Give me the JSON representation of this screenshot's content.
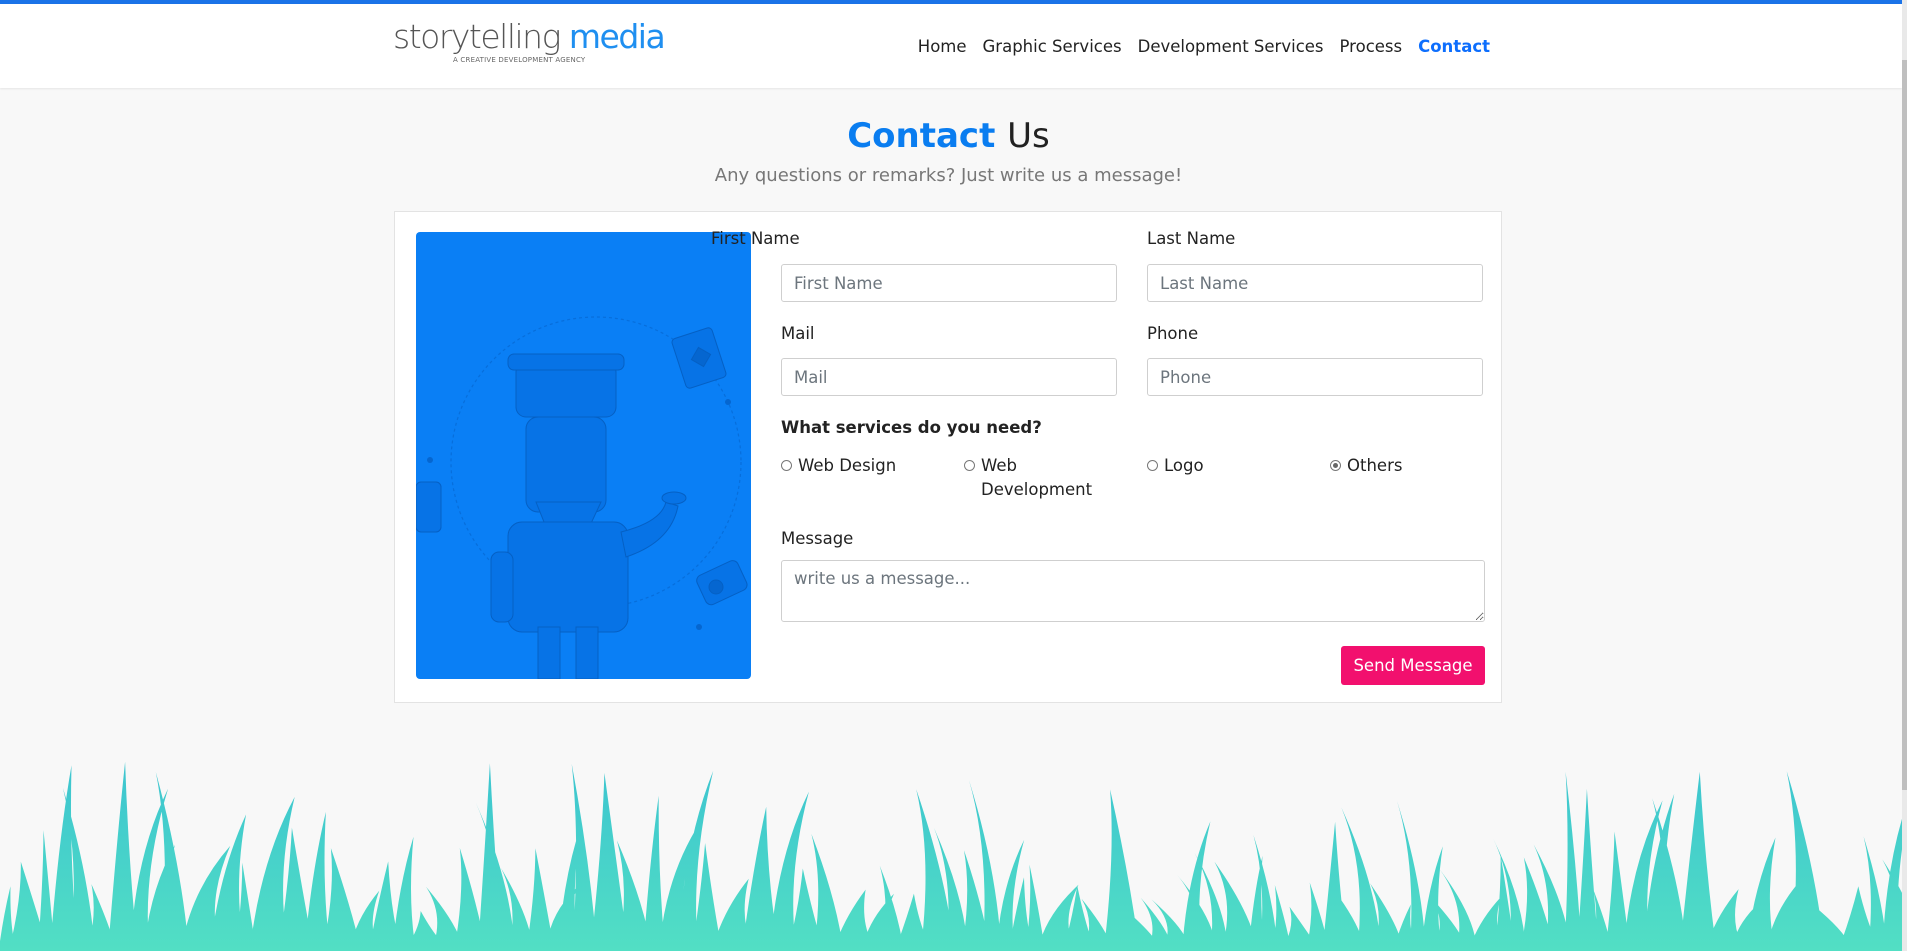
{
  "brand": {
    "logo_part1": "storytelling",
    "logo_part2": "media",
    "tagline": "A CREATIVE DEVELOPMENT AGENCY"
  },
  "nav": {
    "items": [
      {
        "label": "Home"
      },
      {
        "label": "Graphic Services"
      },
      {
        "label": "Development Services"
      },
      {
        "label": "Process"
      },
      {
        "label": "Contact"
      }
    ],
    "active": "Contact"
  },
  "heading": {
    "title_accent": "Contact",
    "title_rest": "Us",
    "subtitle": "Any questions or remarks? Just write us a message!"
  },
  "form": {
    "first_name": {
      "label": "First Name",
      "placeholder": "First Name",
      "value": ""
    },
    "last_name": {
      "label": "Last Name",
      "placeholder": "Last Name",
      "value": ""
    },
    "mail": {
      "label": "Mail",
      "placeholder": "Mail",
      "value": ""
    },
    "phone": {
      "label": "Phone",
      "placeholder": "Phone",
      "value": ""
    },
    "services": {
      "label": "What services do you need?",
      "options": [
        {
          "label": "Web Design",
          "checked": false
        },
        {
          "label": "Web Development",
          "checked": false
        },
        {
          "label": "Logo",
          "checked": false
        },
        {
          "label": "Others",
          "checked": true
        }
      ]
    },
    "message": {
      "label": "Message",
      "placeholder": "write us a message...",
      "value": ""
    },
    "submit_label": "Send Message"
  },
  "colors": {
    "accent": "#0a7df0",
    "button": "#f2106e",
    "grass": "#4dd9c8",
    "top_bar": "#1a73e8"
  }
}
